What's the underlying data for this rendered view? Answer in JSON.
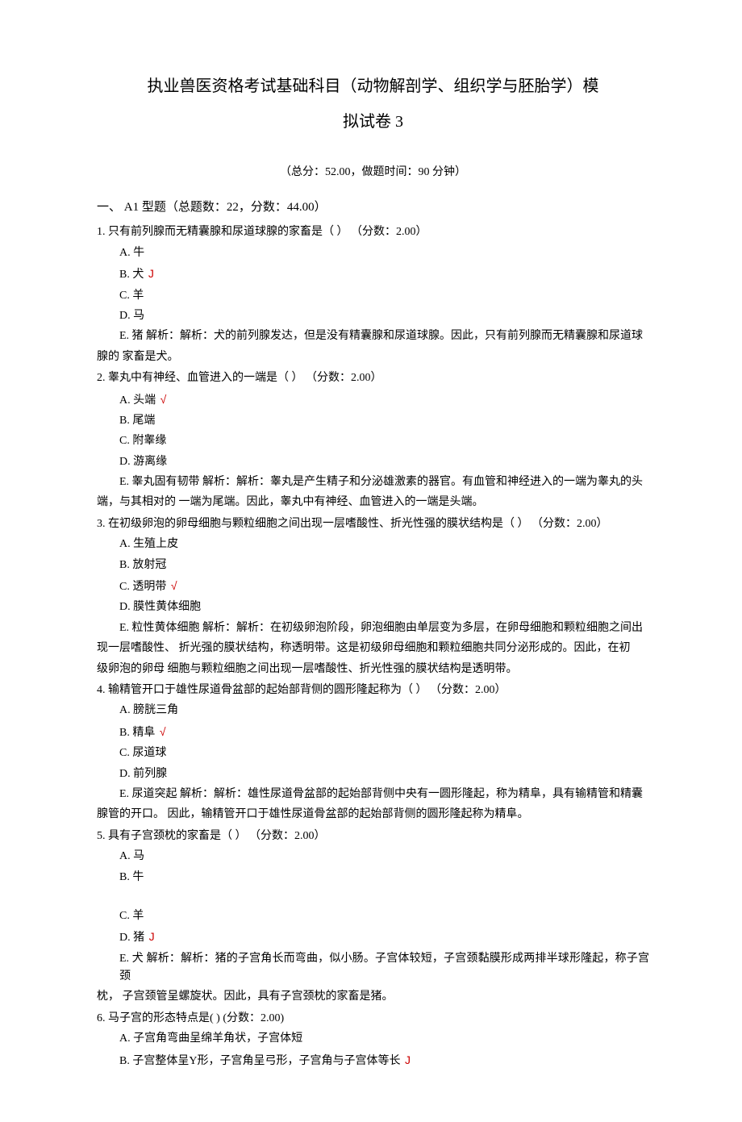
{
  "title_line1": "执业兽医资格考试基础科目（动物解剖学、组织学与胚胎学）模",
  "title_line2": "拟试卷 3",
  "meta": "（总分：52.00，做题时间：90 分钟）",
  "section_header": "一、 A1 型题（总题数：22，分数：44.00）",
  "questions": [
    {
      "stem": "1.  只有前列腺而无精囊腺和尿道球腺的家畜是（ ） （分数：2.00）",
      "options": [
        {
          "label": "A. 牛",
          "correct": false
        },
        {
          "label": "B. 犬",
          "correct": true,
          "mark": "J"
        },
        {
          "label": "C. 羊",
          "correct": false
        },
        {
          "label": "D. 马",
          "correct": false
        }
      ],
      "explanation_first": "E. 猪  解析：解析：犬的前列腺发达，但是没有精囊腺和尿道球腺。因此，只有前列腺而无精囊腺和尿道球",
      "explanation_cont": [
        "腺的 家畜是犬。"
      ]
    },
    {
      "stem": "2. 睾丸中有神经、血管进入的一端是（ ） （分数：2.00）",
      "options": [
        {
          "label": "A. 头端",
          "correct": true,
          "mark": "√"
        },
        {
          "label": "B. 尾端",
          "correct": false
        },
        {
          "label": "C. 附睾缘",
          "correct": false
        },
        {
          "label": "D. 游离缘",
          "correct": false
        }
      ],
      "explanation_first": "E. 睾丸固有韧带  解析：解析：睾丸是产生精子和分泌雄激素的器官。有血管和神经进入的一端为睾丸的头",
      "explanation_cont": [
        "端，与其相对的 一端为尾端。因此，睾丸中有神经、血管进入的一端是头端。"
      ]
    },
    {
      "stem": "3. 在初级卵泡的卵母细胞与颗粒细胞之间出现一层嗜酸性、折光性强的膜状结构是（ ） （分数：2.00）",
      "options": [
        {
          "label": "A. 生殖上皮",
          "correct": false
        },
        {
          "label": "B. 放射冠",
          "correct": false
        },
        {
          "label": "C. 透明带",
          "correct": true,
          "mark": "√"
        },
        {
          "label": "D. 膜性黄体细胞",
          "correct": false
        }
      ],
      "explanation_first": "E. 粒性黄体细胞  解析：解析：在初级卵泡阶段，卵泡细胞由单层变为多层，在卵母细胞和颗粒细胞之间出",
      "explanation_cont": [
        "现一层嗜酸性、 折光强的膜状结构，称透明带。这是初级卵母细胞和颗粒细胞共同分泌形成的。因此，在初",
        "级卵泡的卵母 细胞与颗粒细胞之间出现一层嗜酸性、折光性强的膜状结构是透明带。"
      ]
    },
    {
      "stem": "4. 输精管开口于雄性尿道骨盆部的起始部背侧的圆形隆起称为（ ） （分数：2.00）",
      "options": [
        {
          "label": "A. 膀胱三角",
          "correct": false
        },
        {
          "label": "B. 精阜",
          "correct": true,
          "mark": "√"
        },
        {
          "label": "C. 尿道球",
          "correct": false
        },
        {
          "label": "D. 前列腺",
          "correct": false
        }
      ],
      "explanation_first": "E. 尿道突起  解析：解析：雄性尿道骨盆部的起始部背侧中央有一圆形隆起，称为精阜，具有输精管和精囊",
      "explanation_cont": [
        "腺管的开口。 因此，输精管开口于雄性尿道骨盆部的起始部背侧的圆形隆起称为精阜。"
      ]
    },
    {
      "stem": "5. 具有子宫颈枕的家畜是（ ） （分数：2.00）",
      "options": [
        {
          "label": "A. 马",
          "correct": false
        },
        {
          "label": "B. 牛",
          "correct": false
        }
      ],
      "break_after": 2,
      "options_after": [
        {
          "label": "C. 羊",
          "correct": false
        },
        {
          "label": "D. 猪",
          "correct": true,
          "mark": "J"
        }
      ],
      "explanation_first": "E. 犬  解析：解析：猪的子宫角长而弯曲，似小肠。子宫体较短，子宫颈黏膜形成两排半球形隆起，称子宫颈",
      "explanation_cont": [
        "枕， 子宫颈管呈螺旋状。因此，具有子宫颈枕的家畜是猪。"
      ]
    },
    {
      "stem": "6. 马子宫的形态特点是( ) (分数：2.00)",
      "options": [
        {
          "label": "A. 子宫角弯曲呈绵羊角状，子宫体短",
          "correct": false
        },
        {
          "label": "B. 子宫整体呈Y形，子宫角呈弓形，子宫角与子宫体等长",
          "correct": true,
          "mark": "J"
        }
      ]
    }
  ]
}
